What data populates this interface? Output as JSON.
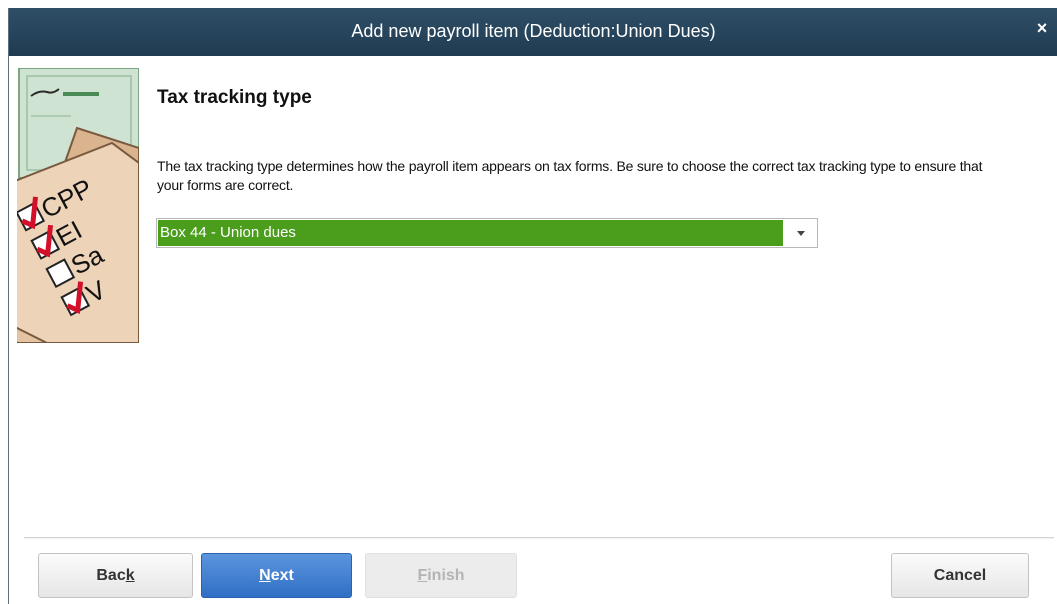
{
  "window": {
    "title": "Add new payroll item (Deduction:Union Dues)",
    "close_glyph": "×"
  },
  "illustration": {
    "icon": "tax-checklist-illustration",
    "items": [
      "CPP",
      "EI",
      "Sa",
      "V"
    ]
  },
  "content": {
    "heading": "Tax tracking type",
    "description": "The tax tracking type determines how the payroll item appears on tax forms.  Be sure to choose the correct tax tracking type to ensure that your forms are correct.",
    "tax_tracking_select": {
      "selected_value": "Box 44 - Union dues",
      "highlight_color": "#4a9e1c"
    }
  },
  "buttons": {
    "back": {
      "label_pre": "Bac",
      "mnemonic": "k",
      "label_post": ""
    },
    "next": {
      "label_pre": "",
      "mnemonic": "N",
      "label_post": "ext"
    },
    "finish": {
      "label_pre": "",
      "mnemonic": "F",
      "label_post": "inish",
      "enabled": false
    },
    "cancel": {
      "label": "Cancel"
    }
  },
  "colors": {
    "titlebar": "#1f3b52",
    "primary_button": "#2f6fc4",
    "selection": "#4a9e1c"
  }
}
